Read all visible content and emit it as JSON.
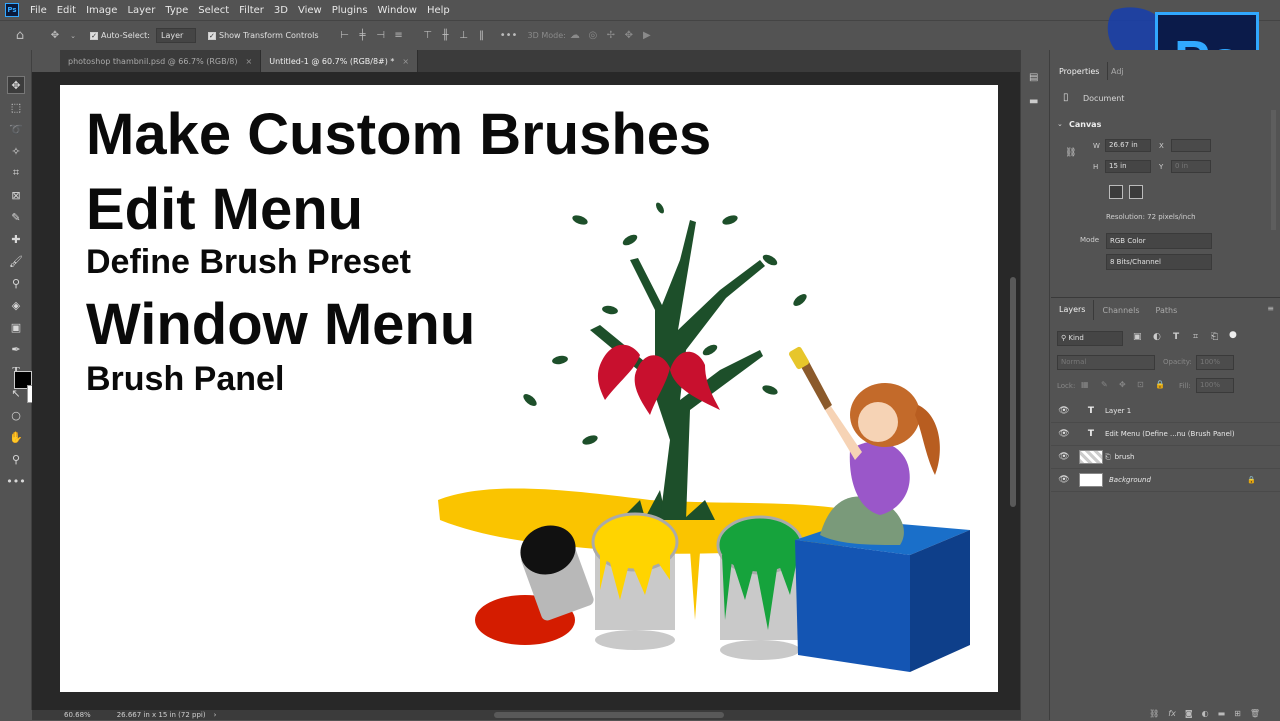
{
  "menubar": {
    "app_badge": "Ps",
    "items": [
      "File",
      "Edit",
      "Image",
      "Layer",
      "Type",
      "Select",
      "Filter",
      "3D",
      "View",
      "Plugins",
      "Window",
      "Help"
    ]
  },
  "options_bar": {
    "auto_select_label": "Auto-Select:",
    "auto_select_target": "Layer",
    "show_transform_label": "Show Transform Controls",
    "three_d_mode_label": "3D Mode:"
  },
  "tabs": [
    {
      "label": "photoshop thambnil.psd @ 66.7% (RGB/8)"
    },
    {
      "label": "Untitled-1 @ 60.7% (RGB/8#) *"
    }
  ],
  "canvas": {
    "line1": "Make Custom Brushes",
    "line2": "Edit Menu",
    "line3": "Define Brush Preset",
    "line4": "Window Menu",
    "line5": "Brush Panel"
  },
  "properties": {
    "tab_properties": "Properties",
    "tab_adjust": "Adj",
    "doc_label": "Document",
    "canvas_section": "Canvas",
    "w_label": "W",
    "w_value": "26.67 in",
    "h_label": "H",
    "h_value": "15 in",
    "x_label": "X",
    "y_label": "Y",
    "y_value": "0 in",
    "resolution": "Resolution: 72 pixels/inch",
    "mode_label": "Mode",
    "mode_value": "RGB Color",
    "bits_value": "8 Bits/Channel"
  },
  "layers_panel": {
    "tabs": [
      "Layers",
      "Channels",
      "Paths"
    ],
    "kind_label": "Kind",
    "blend_mode": "Normal",
    "opacity_label": "Opacity:",
    "opacity_value": "100%",
    "lock_label": "Lock:",
    "fill_label": "Fill:",
    "fill_value": "100%",
    "layers": [
      {
        "name": "Layer 1",
        "type": "text"
      },
      {
        "name": "Edit Menu (Define ...nu (Brush Panel)",
        "type": "text"
      },
      {
        "name": "brush",
        "type": "smart"
      },
      {
        "name": "Background",
        "type": "background"
      }
    ]
  },
  "status": {
    "zoom": "60.68%",
    "doc_size": "26.667 in x 15 in (72 ppi)"
  },
  "colors": {
    "accent": "#31a8ff",
    "canvas": "#ffffff",
    "panel": "#535353"
  }
}
